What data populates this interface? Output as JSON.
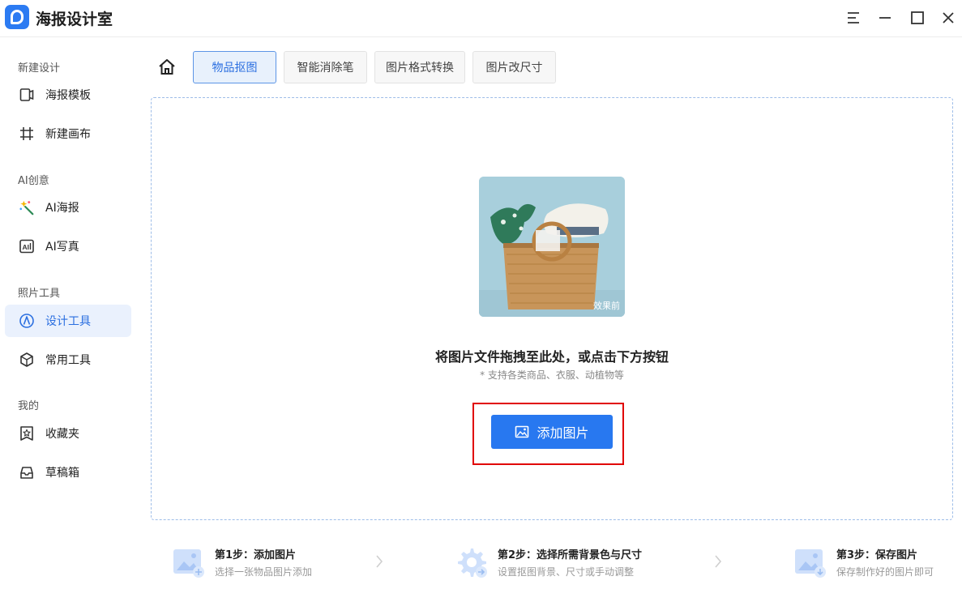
{
  "app": {
    "title": "海报设计室"
  },
  "sidebar": {
    "sections": [
      {
        "label": "新建设计"
      },
      {
        "label": "AI创意"
      },
      {
        "label": "照片工具"
      },
      {
        "label": "我的"
      }
    ],
    "items": [
      {
        "label": "海报模板",
        "icon": "poster-template-icon"
      },
      {
        "label": "新建画布",
        "icon": "canvas-grid-icon"
      },
      {
        "label": "AI海报",
        "icon": "magic-wand-icon"
      },
      {
        "label": "AI写真",
        "icon": "ai-portrait-icon"
      },
      {
        "label": "设计工具",
        "icon": "design-tool-icon",
        "active": true
      },
      {
        "label": "常用工具",
        "icon": "cube-icon"
      },
      {
        "label": "收藏夹",
        "icon": "favorite-star-icon"
      },
      {
        "label": "草稿箱",
        "icon": "drafts-tray-icon"
      }
    ]
  },
  "tabs": [
    {
      "label": "物品抠图",
      "active": true
    },
    {
      "label": "智能消除笔"
    },
    {
      "label": "图片格式转换"
    },
    {
      "label": "图片改尺寸"
    }
  ],
  "dropzone": {
    "sample_badge": "效果前",
    "title": "将图片文件拖拽至此处，或点击下方按钮",
    "subtitle": "* 支持各类商品、衣服、动植物等",
    "add_button": "添加图片"
  },
  "steps": [
    {
      "title": "第1步：添加图片",
      "desc": "选择一张物品图片添加"
    },
    {
      "title": "第2步：选择所需背景色与尺寸",
      "desc": "设置抠图背景、尺寸或手动调整"
    },
    {
      "title": "第3步：保存图片",
      "desc": "保存制作好的图片即可"
    }
  ],
  "colors": {
    "accent": "#2878f0",
    "highlight": "#e00000",
    "active_bg": "#eaf1fd"
  }
}
